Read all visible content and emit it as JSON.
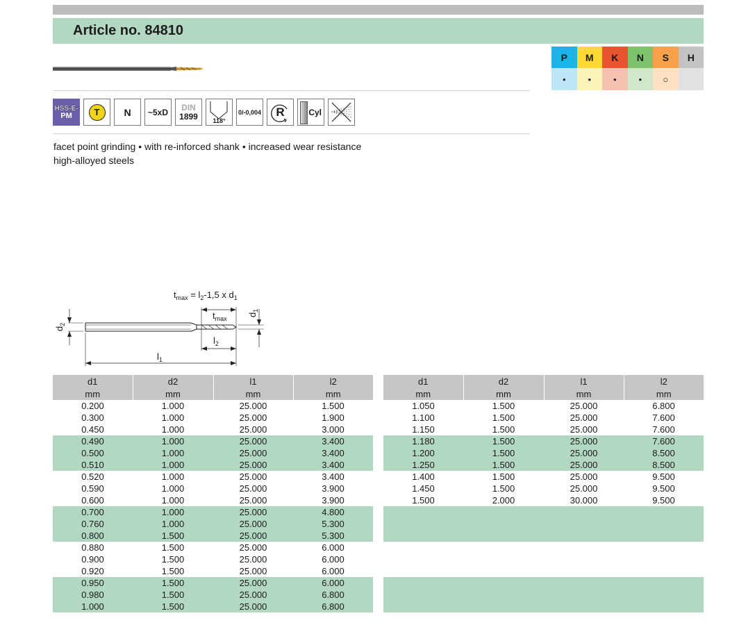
{
  "title": "Article no. 84810",
  "icons": {
    "hss": [
      "HSS-E-",
      "PM"
    ],
    "coating": "T",
    "type": "N",
    "length": "~5xD",
    "din_top": "DIN",
    "din_num": "1899",
    "angle": "118°",
    "tolerance": "0/-0,004",
    "direction": "R",
    "shank": "Cyl"
  },
  "materials": {
    "headers": [
      "P",
      "M",
      "K",
      "N",
      "S",
      "H"
    ],
    "values": [
      "•",
      "•",
      "•",
      "•",
      "○",
      ""
    ],
    "header_colors": [
      "#19b5e9",
      "#fcd834",
      "#e8542f",
      "#7cc36c",
      "#f5a24b",
      "#c3c3c3"
    ],
    "value_colors": [
      "#bde7f6",
      "#fdf2b7",
      "#f6c1b0",
      "#cfe8c8",
      "#fde1c2",
      "#e1e1e1"
    ]
  },
  "description": {
    "line1": "facet point grinding • with re-inforced shank • increased wear resistance",
    "line2": "high-alloyed steels"
  },
  "drawing": {
    "formula": "t_max = l2-1,5 x d1",
    "labels": {
      "d2": "d2",
      "d1": "d1",
      "tmax": "tmax",
      "l2": "l2",
      "l1": "l1"
    }
  },
  "table": {
    "headers": [
      "d1",
      "d2",
      "l1",
      "l2"
    ],
    "units": [
      "mm",
      "mm",
      "mm",
      "mm"
    ],
    "left": [
      [
        "0.200",
        "1.000",
        "25.000",
        "1.500"
      ],
      [
        "0.300",
        "1.000",
        "25.000",
        "1.900"
      ],
      [
        "0.450",
        "1.000",
        "25.000",
        "3.000"
      ],
      [
        "0.490",
        "1.000",
        "25.000",
        "3.400"
      ],
      [
        "0.500",
        "1.000",
        "25.000",
        "3.400"
      ],
      [
        "0.510",
        "1.000",
        "25.000",
        "3.400"
      ],
      [
        "0.520",
        "1.000",
        "25.000",
        "3.400"
      ],
      [
        "0.590",
        "1.000",
        "25.000",
        "3.900"
      ],
      [
        "0.600",
        "1.000",
        "25.000",
        "3.900"
      ],
      [
        "0.700",
        "1.000",
        "25.000",
        "4.800"
      ],
      [
        "0.760",
        "1.000",
        "25.000",
        "5.300"
      ],
      [
        "0.800",
        "1.500",
        "25.000",
        "5.300"
      ],
      [
        "0.880",
        "1.500",
        "25.000",
        "6.000"
      ],
      [
        "0.900",
        "1.500",
        "25.000",
        "6.000"
      ],
      [
        "0.920",
        "1.500",
        "25.000",
        "6.000"
      ],
      [
        "0.950",
        "1.500",
        "25.000",
        "6.000"
      ],
      [
        "0.980",
        "1.500",
        "25.000",
        "6.800"
      ],
      [
        "1.000",
        "1.500",
        "25.000",
        "6.800"
      ]
    ],
    "right": [
      [
        "1.050",
        "1.500",
        "25.000",
        "6.800"
      ],
      [
        "1.100",
        "1.500",
        "25.000",
        "7.600"
      ],
      [
        "1.150",
        "1.500",
        "25.000",
        "7.600"
      ],
      [
        "1.180",
        "1.500",
        "25.000",
        "7.600"
      ],
      [
        "1.200",
        "1.500",
        "25.000",
        "8.500"
      ],
      [
        "1.250",
        "1.500",
        "25.000",
        "8.500"
      ],
      [
        "1.400",
        "1.500",
        "25.000",
        "9.500"
      ],
      [
        "1.450",
        "1.500",
        "25.000",
        "9.500"
      ],
      [
        "1.500",
        "2.000",
        "30.000",
        "9.500"
      ],
      [
        "",
        "",
        "",
        ""
      ],
      [
        "",
        "",
        "",
        ""
      ],
      [
        "",
        "",
        "",
        ""
      ],
      [
        "",
        "",
        "",
        ""
      ],
      [
        "",
        "",
        "",
        ""
      ],
      [
        "",
        "",
        "",
        ""
      ],
      [
        "",
        "",
        "",
        ""
      ],
      [
        "",
        "",
        "",
        ""
      ],
      [
        "",
        "",
        "",
        ""
      ]
    ]
  }
}
